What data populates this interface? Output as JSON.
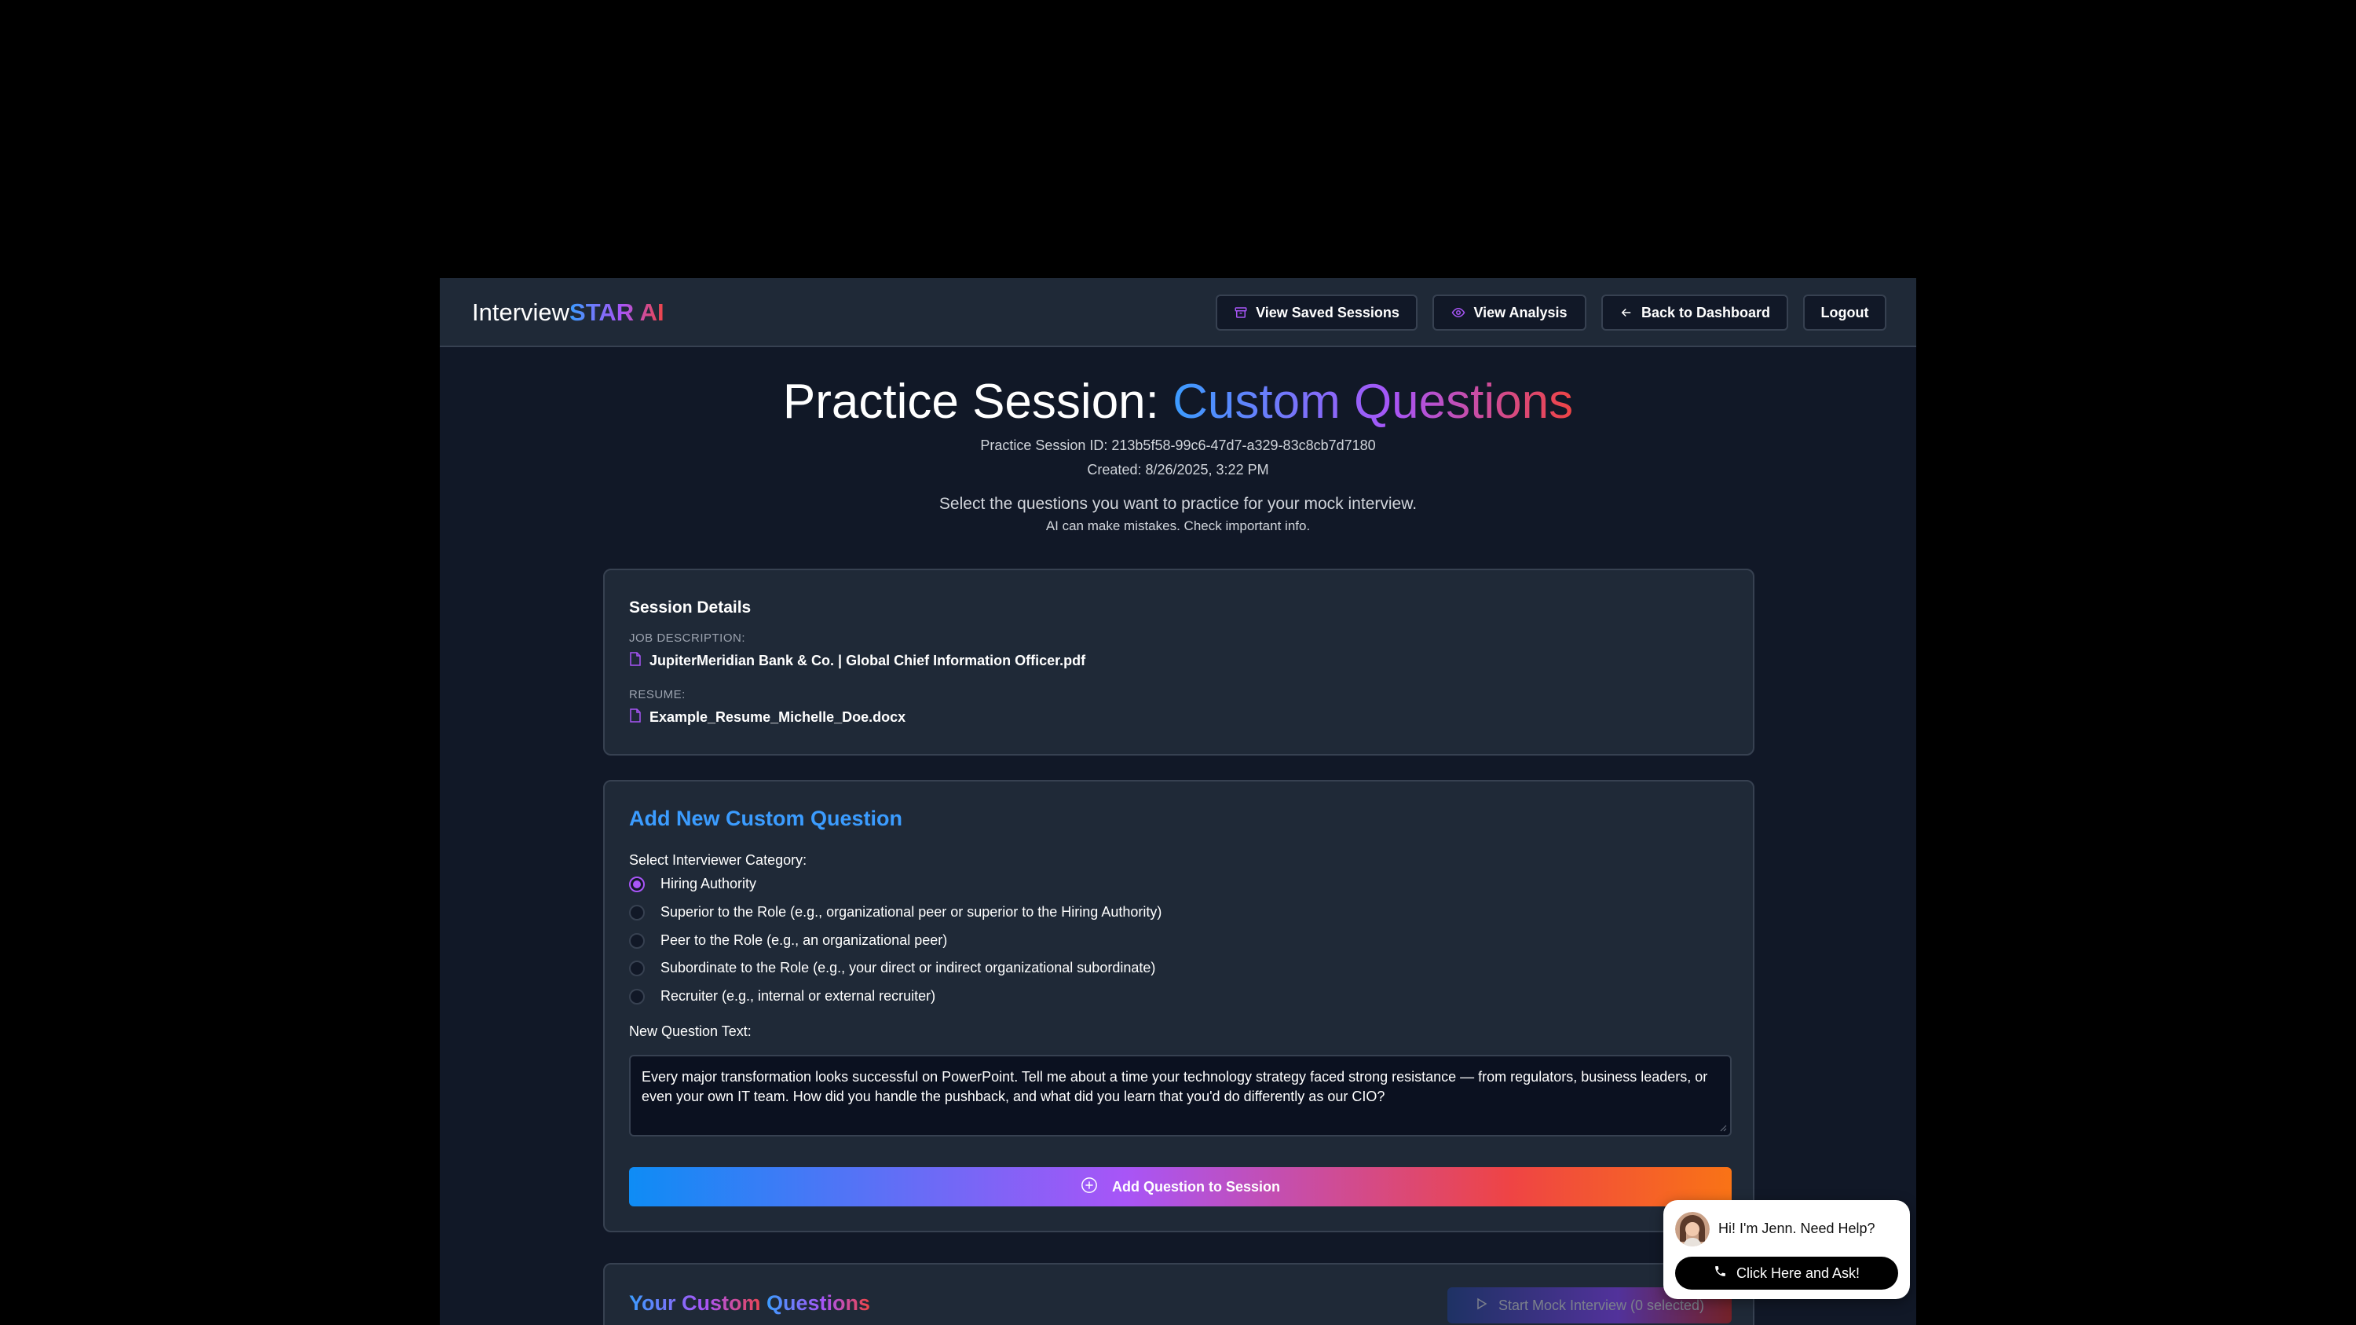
{
  "brand": {
    "prefix": "Interview",
    "accent": "STAR AI"
  },
  "nav": {
    "saved_sessions": "View Saved Sessions",
    "analysis": "View Analysis",
    "dashboard": "Back to Dashboard",
    "logout": "Logout"
  },
  "page": {
    "title_prefix": "Practice Session: ",
    "title_accent": "Custom Questions",
    "session_id": "Practice Session ID: 213b5f58-99c6-47d7-a329-83c8cb7d7180",
    "created": "Created: 8/26/2025, 3:22 PM",
    "intro": "Select the questions you want to practice for your mock interview.",
    "disclaimer": "AI can make mistakes. Check important info."
  },
  "session_details": {
    "heading": "Session Details",
    "job_label": "JOB DESCRIPTION:",
    "job_file": "JupiterMeridian Bank & Co. | Global Chief Information Officer.pdf",
    "resume_label": "RESUME:",
    "resume_file": "Example_Resume_Michelle_Doe.docx"
  },
  "add_question": {
    "heading": "Add New Custom Question",
    "category_label": "Select Interviewer Category:",
    "categories": [
      {
        "label": "Hiring Authority",
        "selected": true
      },
      {
        "label": "Superior to the Role (e.g., organizational peer or superior to the Hiring Authority)",
        "selected": false
      },
      {
        "label": "Peer to the Role (e.g., an organizational peer)",
        "selected": false
      },
      {
        "label": "Subordinate to the Role (e.g., your direct or indirect organizational subordinate)",
        "selected": false
      },
      {
        "label": "Recruiter (e.g., internal or external recruiter)",
        "selected": false
      }
    ],
    "text_label": "New Question Text:",
    "text_value": "Every major transformation looks successful on PowerPoint. Tell me about a time your technology strategy faced strong resistance — from regulators, business leaders, or even your own IT team. How did you handle the pushback, and what did you learn that you'd do differently as our CIO?",
    "submit": "Add Question to Session"
  },
  "custom_questions": {
    "heading_prefix": "Your Custom ",
    "heading_accent": "Questions",
    "start_button": "Start Mock Interview (0 selected)"
  },
  "chat": {
    "greeting": "Hi! I'm Jenn. Need Help?",
    "cta": "Click Here and Ask!"
  },
  "colors": {
    "background": "#111827",
    "card": "#1f2937",
    "border": "#374151",
    "accent_blue": "#3b9cff",
    "accent_purple": "#a855f7",
    "accent_red": "#ef4444"
  }
}
